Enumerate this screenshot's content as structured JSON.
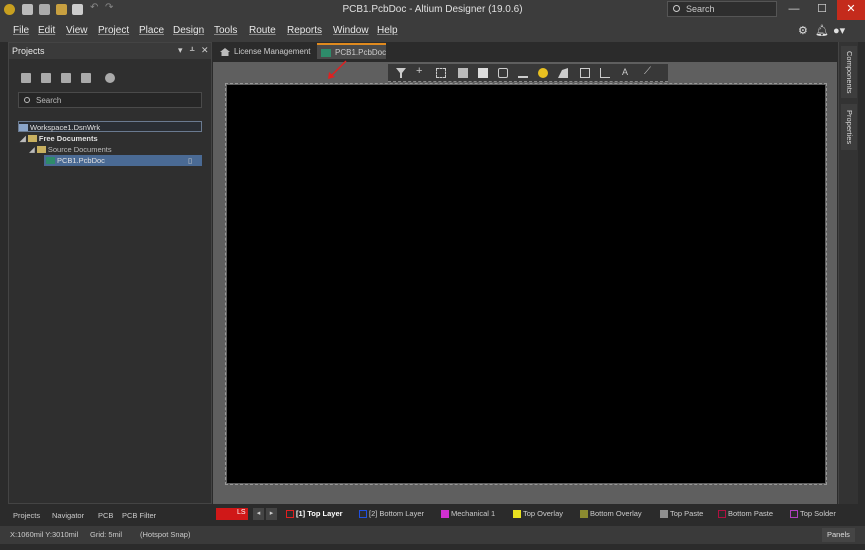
{
  "window": {
    "title": "PCB1.PcbDoc - Altium Designer (19.0.6)",
    "search_placeholder": "Search",
    "minimize": "—",
    "maximize": "☐",
    "close": "✕"
  },
  "menu": {
    "items": [
      "File",
      "Edit",
      "View",
      "Project",
      "Place",
      "Design",
      "Tools",
      "Route",
      "Reports",
      "Window",
      "Help"
    ]
  },
  "projects_panel": {
    "title": "Projects",
    "search_placeholder": "Search",
    "tree": {
      "workspace": "Workspace1.DsnWrk",
      "free_documents": "Free Documents",
      "source_documents": "Source Documents",
      "pcb_doc": "PCB1.PcbDoc"
    }
  },
  "doc_tabs": [
    "License Management",
    "PCB1.PcbDoc"
  ],
  "right_panel_tabs": [
    "Components",
    "Properties"
  ],
  "bottom_panel_tabs": [
    "Projects",
    "Navigator",
    "PCB",
    "PCB Filter"
  ],
  "layer_nav": {
    "label": "LS"
  },
  "layers": [
    {
      "name": "[1] Top Layer",
      "color": "#e02020",
      "active": true
    },
    {
      "name": "[2] Bottom Layer",
      "color": "#2050e0",
      "active": false
    },
    {
      "name": "Mechanical 1",
      "color": "#d030d0",
      "active": false
    },
    {
      "name": "Top Overlay",
      "color": "#e8e020",
      "active": false
    },
    {
      "name": "Bottom Overlay",
      "color": "#8a8a30",
      "active": false
    },
    {
      "name": "Top Paste",
      "color": "#909090",
      "active": false
    },
    {
      "name": "Bottom Paste",
      "color": "#b01040",
      "active": false
    },
    {
      "name": "Top Solder",
      "color": "#b040c0",
      "active": false
    }
  ],
  "status": {
    "coords": "X:1060mil Y:3010mil",
    "grid": "Grid: 5mil",
    "snap": "(Hotspot Snap)",
    "panels_button": "Panels"
  }
}
